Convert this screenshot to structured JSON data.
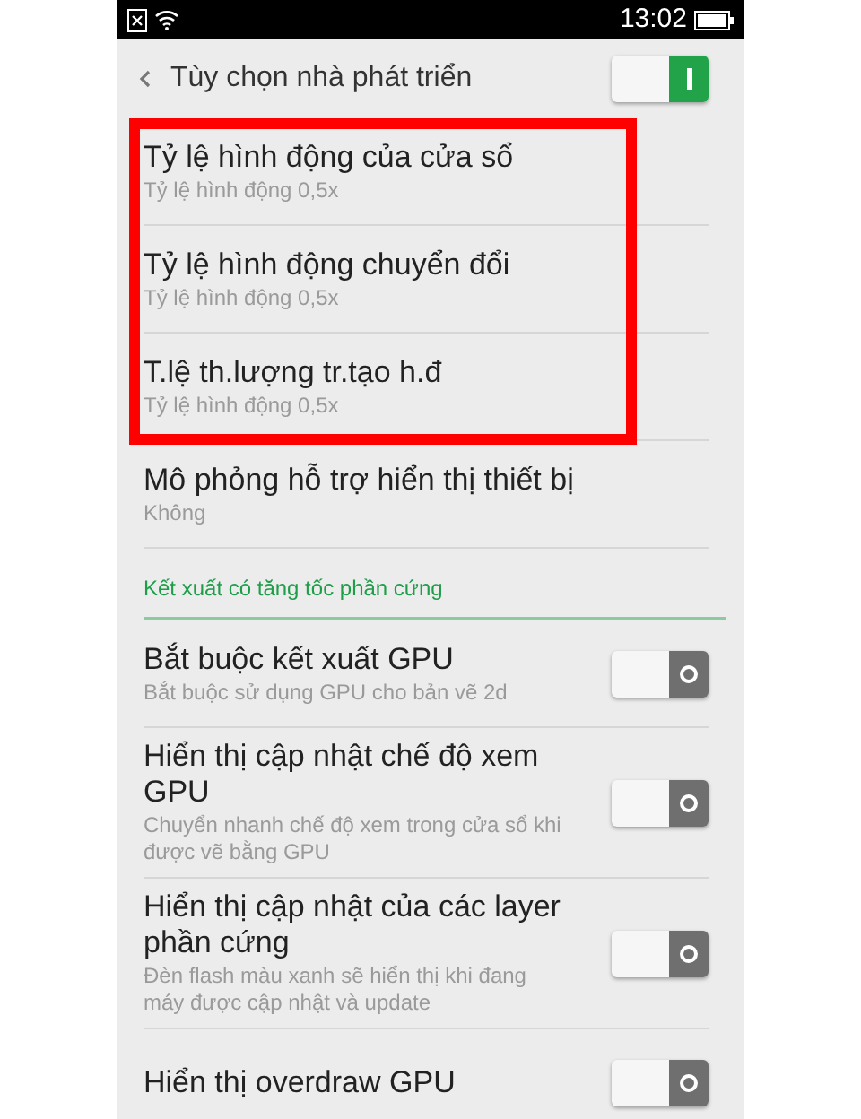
{
  "status_bar": {
    "time": "13:02"
  },
  "header": {
    "title": "Tùy chọn nhà phát triển",
    "on": true
  },
  "items": [
    {
      "kind": "option",
      "title": "Tỷ lệ hình động của cửa sổ",
      "summary": "Tỷ lệ hình động 0,5x",
      "highlighted": true
    },
    {
      "kind": "option",
      "title": "Tỷ lệ hình động chuyển đổi",
      "summary": "Tỷ lệ hình động 0,5x",
      "highlighted": true
    },
    {
      "kind": "option",
      "title": "T.lệ th.lượng tr.tạo h.đ",
      "summary": "Tỷ lệ hình động 0,5x",
      "highlighted": true
    },
    {
      "kind": "option",
      "title": "Mô phỏng hỗ trợ hiển thị thiết bị",
      "summary": "Không",
      "highlighted": false
    },
    {
      "kind": "section",
      "title": "Kết xuất có tăng tốc phần cứng",
      "highlighted": false
    },
    {
      "kind": "toggle",
      "title": "Bắt buộc kết xuất GPU",
      "summary": "Bắt buộc sử dụng GPU cho bản vẽ 2d",
      "on": false,
      "highlighted": false
    },
    {
      "kind": "toggle",
      "title": "Hiển thị cập nhật chế độ xem GPU",
      "summary": "Chuyển nhanh chế độ xem trong cửa sổ khi được vẽ bằng GPU",
      "on": false,
      "highlighted": false
    },
    {
      "kind": "toggle",
      "title": "Hiển thị cập nhật của các layer phần cứng",
      "summary": "Đèn flash màu xanh sẽ hiển thị khi đang máy được cập nhật và update",
      "on": false,
      "highlighted": false
    },
    {
      "kind": "toggle",
      "title": "Hiển thị overdraw GPU",
      "on": false,
      "highlighted": false
    }
  ]
}
